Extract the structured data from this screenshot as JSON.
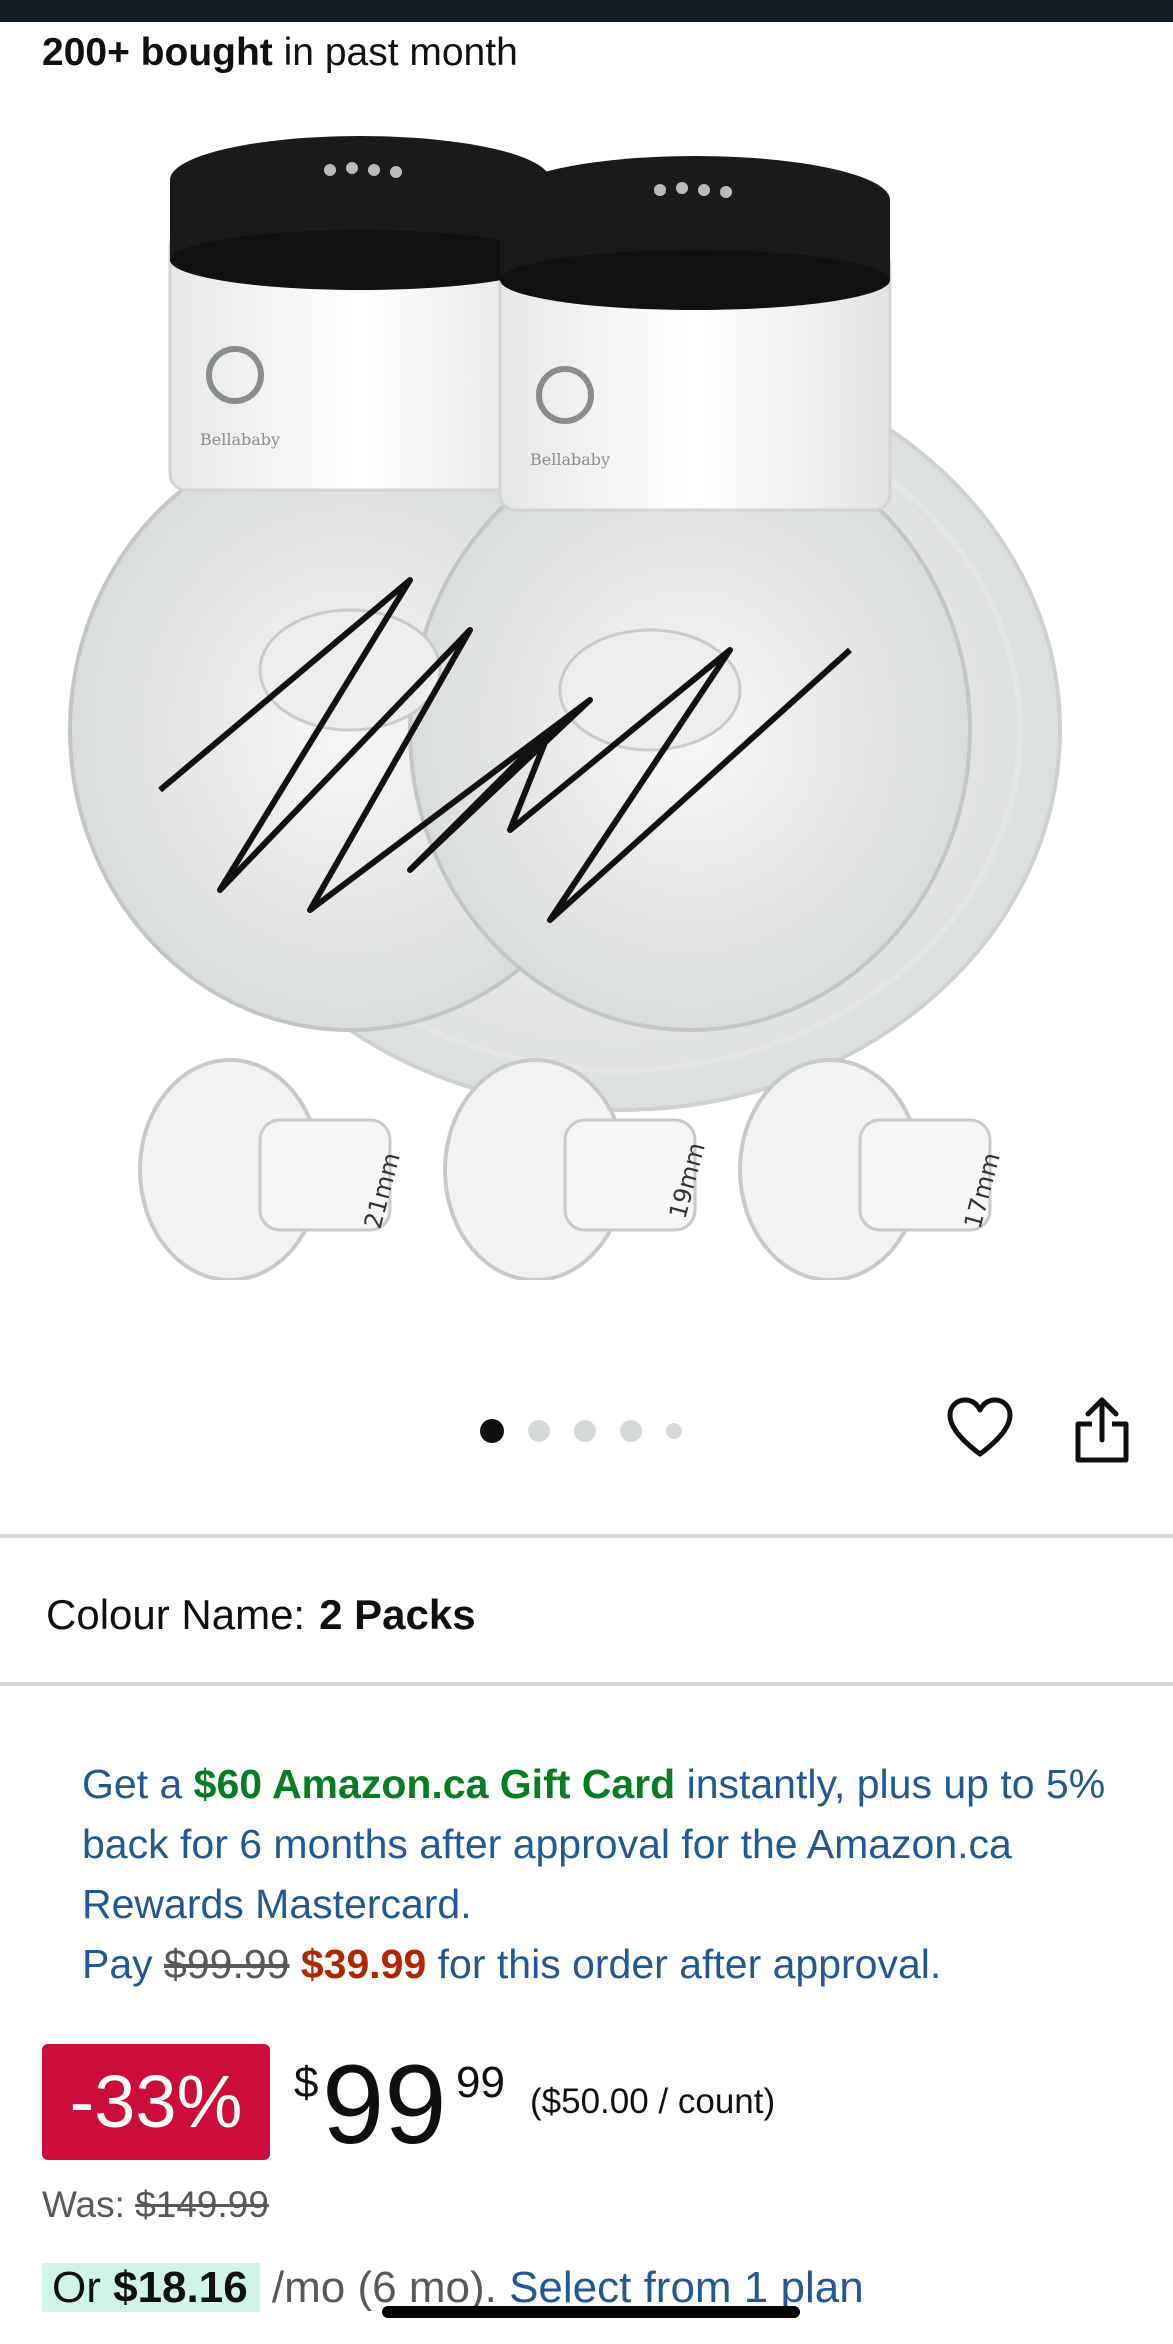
{
  "header": {
    "bought_count": "200+ bought",
    "bought_suffix": " in past month"
  },
  "gallery": {
    "image_alt": "Bellababy wearable breast pump, 2 pack",
    "brand_text": "Bellababy",
    "flange_sizes": [
      "21mm",
      "19mm",
      "17mm"
    ],
    "active_dot": 0,
    "dot_count": 5,
    "icons": [
      "heart-icon",
      "share-icon"
    ]
  },
  "variation": {
    "label": "Colour Name:",
    "value": "2 Packs"
  },
  "promo": {
    "part1": "Get a ",
    "gift": "$60 Amazon.ca Gift Card",
    "part2": " instantly, plus up to 5% back for 6 months after approval for the Amazon.ca Rewards Mastercard.",
    "pay_prefix": "Pay ",
    "old_price": "$99.99",
    "new_price": "$39.99",
    "pay_suffix": " for this order after approval."
  },
  "pricing": {
    "discount": "-33%",
    "currency": "$",
    "whole": "99",
    "fraction": "99",
    "unit_price": "($50.00 / count)",
    "was_label": "Was: ",
    "was_price": "$149.99"
  },
  "installment": {
    "prefix": "Or ",
    "amount": "$18.16",
    "period": " /mo (6 mo). ",
    "link": "Select from 1 plan"
  },
  "colors": {
    "deal_red": "#cc0c39",
    "link_blue": "#1f5a96",
    "gift_green": "#067d1f",
    "price_red": "#b12704",
    "installment_bg": "#cff5e6"
  }
}
